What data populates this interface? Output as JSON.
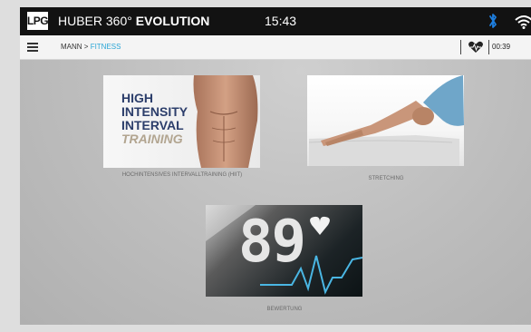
{
  "header": {
    "logo": "LPG",
    "app_name": "HUBER 360°",
    "app_name_bold": "EVOLUTION",
    "time": "15:43",
    "icons": [
      "bluetooth-icon",
      "wifi-icon"
    ]
  },
  "navbar": {
    "menu_icon": "hamburger-menu-icon",
    "breadcrumb_root": "MANN >",
    "breadcrumb_current": "FITNESS",
    "heart_icon": "heart-rate-icon",
    "timer": "00:39"
  },
  "cards": [
    {
      "image_text": [
        "HIGH",
        "INTENSITY",
        "INTERVAL",
        "TRAINING"
      ],
      "label": "HOCHINTENSIVES INTERVALLTRAINING (HIIT)"
    },
    {
      "label": "STRETCHING"
    },
    {
      "image_text": [
        "89"
      ],
      "label": "BEWERTUNG"
    }
  ],
  "colors": {
    "accent": "#2aa6d6",
    "topbar": "#121212",
    "bluetooth": "#1e7fe0"
  }
}
